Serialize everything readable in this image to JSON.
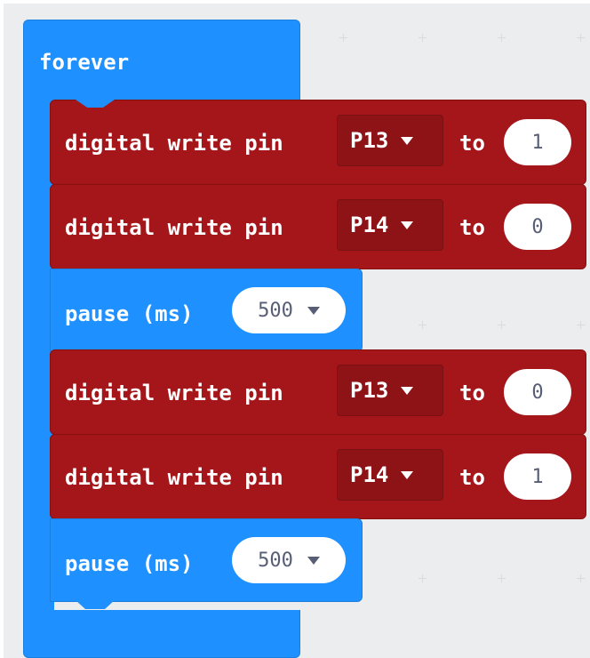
{
  "event_block": {
    "label": "forever"
  },
  "write_label": "digital write pin",
  "to_label": "to",
  "pause_label": "pause (ms)",
  "blocks": [
    {
      "type": "digital_write",
      "pin": "P13",
      "value": "1"
    },
    {
      "type": "digital_write",
      "pin": "P14",
      "value": "0"
    },
    {
      "type": "pause",
      "ms": "500"
    },
    {
      "type": "digital_write",
      "pin": "P13",
      "value": "0"
    },
    {
      "type": "digital_write",
      "pin": "P14",
      "value": "1"
    },
    {
      "type": "pause",
      "ms": "500"
    }
  ],
  "colors": {
    "workspace": "#ecedee",
    "loop_block": "#1e90ff",
    "pins_block": "#a4161a",
    "dropdown_field": "#8e1316"
  },
  "icons": [
    "dropdown-arrow-icon"
  ]
}
